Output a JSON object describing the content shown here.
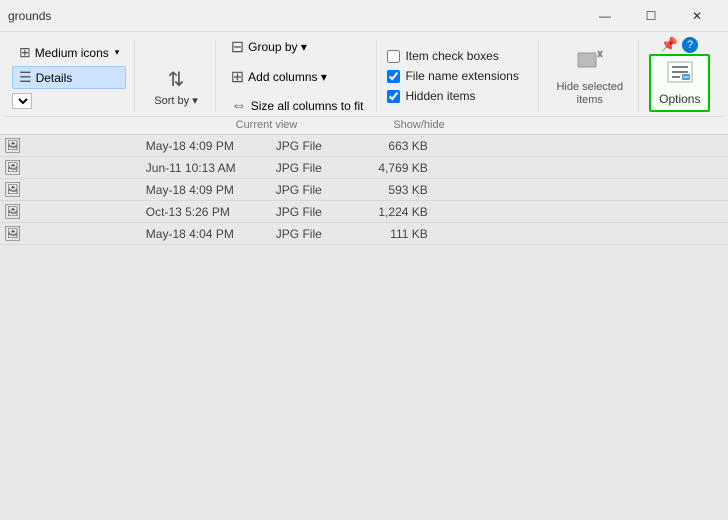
{
  "window": {
    "title": "grounds",
    "controls": {
      "minimize": "—",
      "maximize": "☐",
      "close": "✕"
    }
  },
  "ribbon": {
    "views": {
      "medium_icons_label": "Medium icons",
      "details_label": "Details"
    },
    "sort": {
      "label": "Sort by ▾",
      "section_label": ""
    },
    "current_view": {
      "group_by": "Group by ▾",
      "add_columns": "Add columns ▾",
      "size_all": "Size all columns to fit",
      "section_label": "Current view"
    },
    "show_hide": {
      "item_checkboxes": "Item check boxes",
      "file_name_extensions": "File name extensions",
      "hidden_items": "Hidden items",
      "section_label": "Show/hide",
      "file_name_checked": true,
      "hidden_checked": true
    },
    "hide_selected": {
      "label": "Hide selected\nitems",
      "section_label": ""
    },
    "options": {
      "label": "Options",
      "section_label": ""
    }
  },
  "files": {
    "rows": [
      {
        "name": "",
        "date": "May-18 4:09 PM",
        "type": "JPG File",
        "size": "663 KB"
      },
      {
        "name": "",
        "date": "Jun-11 10:13 AM",
        "type": "JPG File",
        "size": "4,769 KB"
      },
      {
        "name": "",
        "date": "May-18 4:09 PM",
        "type": "JPG File",
        "size": "593 KB"
      },
      {
        "name": "",
        "date": "Oct-13 5:26 PM",
        "type": "JPG File",
        "size": "1,224 KB"
      },
      {
        "name": "",
        "date": "May-18 4:04 PM",
        "type": "JPG File",
        "size": "111 KB"
      }
    ]
  }
}
